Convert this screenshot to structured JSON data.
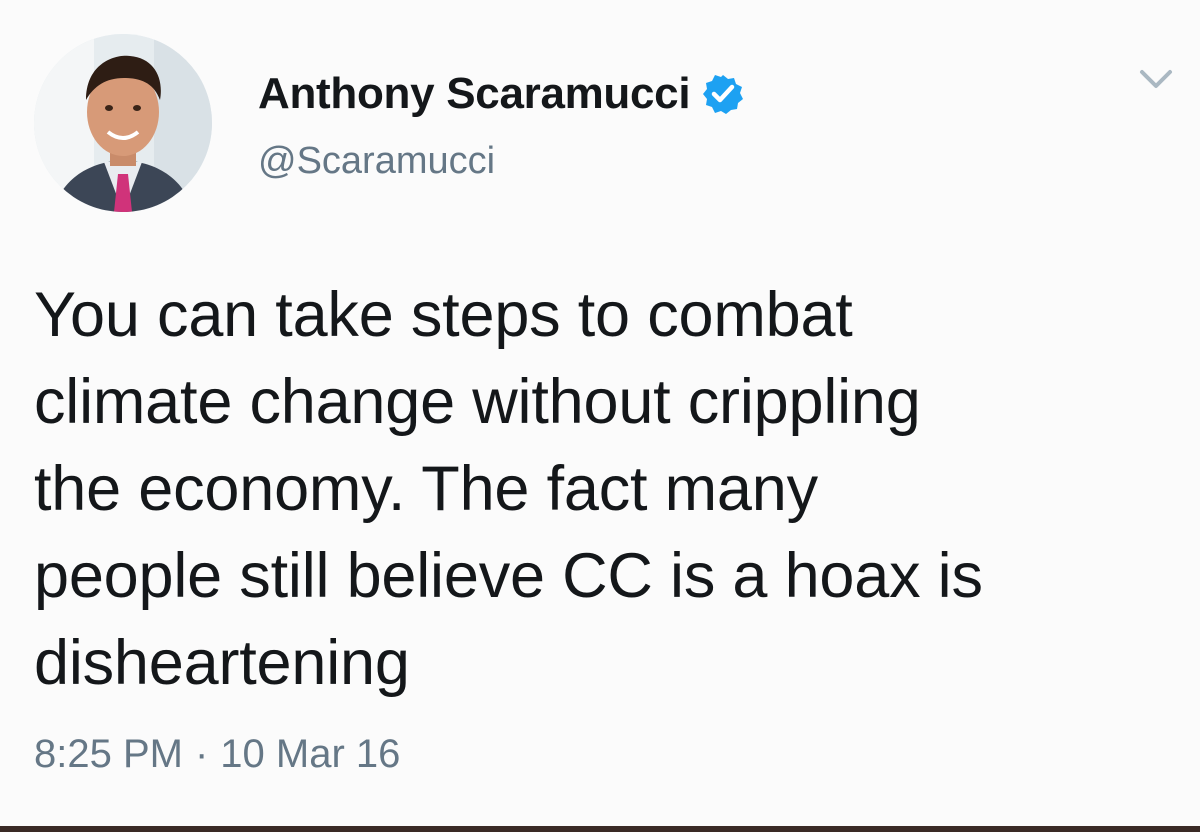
{
  "tweet": {
    "author": {
      "display_name": "Anthony Scaramucci",
      "handle": "@Scaramucci",
      "verified": true,
      "avatar_icon": "profile-photo"
    },
    "text": "You can take steps to combat\nclimate change without crippling\nthe economy. The fact many\npeople still believe CC is a hoax is\ndisheartening",
    "time": "8:25 PM",
    "separator": "·",
    "date": "10 Mar 16",
    "menu_icon": "chevron-down-icon"
  },
  "colors": {
    "verified_blue": "#1da1f2",
    "text_primary": "#14171a",
    "text_secondary": "#657786",
    "bottom_border": "#3a2a25"
  }
}
